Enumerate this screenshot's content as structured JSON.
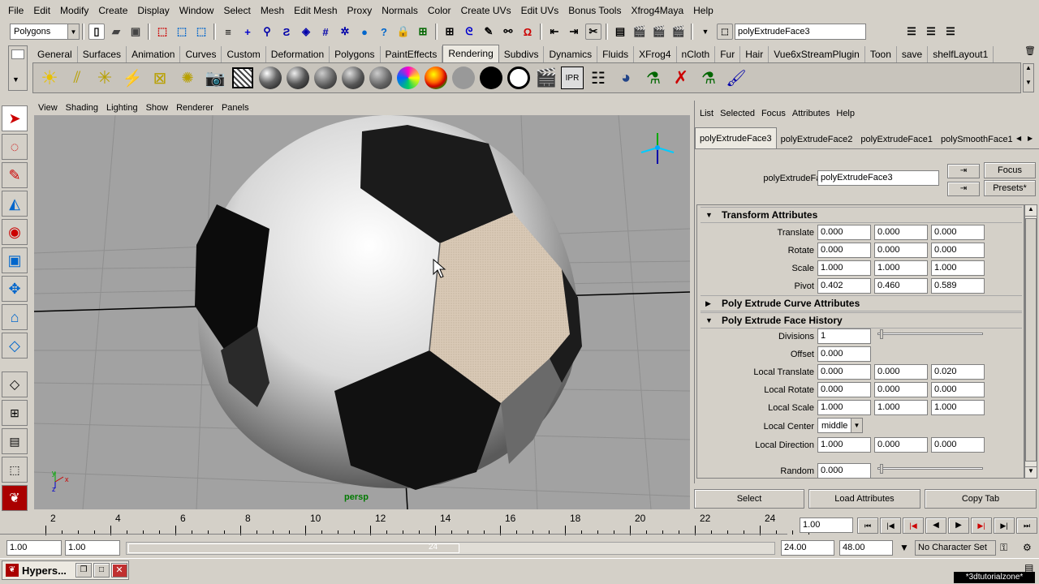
{
  "menubar": [
    "File",
    "Edit",
    "Modify",
    "Create",
    "Display",
    "Window",
    "Select",
    "Mesh",
    "Edit Mesh",
    "Proxy",
    "Normals",
    "Color",
    "Create UVs",
    "Edit UVs",
    "Bonus Tools",
    "Xfrog4Maya",
    "Help"
  ],
  "status": {
    "menuset": "Polygons",
    "name_field": "polyExtrudeFace3"
  },
  "shelf_tabs": [
    "General",
    "Surfaces",
    "Animation",
    "Curves",
    "Custom",
    "Deformation",
    "Polygons",
    "PaintEffects",
    "Rendering",
    "Subdivs",
    "Dynamics",
    "Fluids",
    "XFrog4",
    "nCloth",
    "Fur",
    "Hair",
    "Vue6xStreamPlugin",
    "Toon",
    "save",
    "shelfLayout1"
  ],
  "active_shelf_tab": "Rendering",
  "viewport": {
    "menu": [
      "View",
      "Shading",
      "Lighting",
      "Show",
      "Renderer",
      "Panels"
    ],
    "camera_label": "persp",
    "axis": {
      "x": "x",
      "y": "y",
      "z": "z"
    }
  },
  "ae": {
    "menu": [
      "List",
      "Selected",
      "Focus",
      "Attributes",
      "Help"
    ],
    "tabs": [
      "polyExtrudeFace3",
      "polyExtrudeFace2",
      "polyExtrudeFace1",
      "polySmoothFace1"
    ],
    "node_label": "polyExtrudeFace:",
    "node_value": "polyExtrudeFace3",
    "focus_btn": "Focus",
    "presets_btn": "Presets*",
    "sections": {
      "transform": "Transform Attributes",
      "curve": "Poly Extrude Curve Attributes",
      "history": "Poly Extrude Face History"
    },
    "transform_rows": [
      {
        "label": "Translate",
        "v": [
          "0.000",
          "0.000",
          "0.000"
        ]
      },
      {
        "label": "Rotate",
        "v": [
          "0.000",
          "0.000",
          "0.000"
        ]
      },
      {
        "label": "Scale",
        "v": [
          "1.000",
          "1.000",
          "1.000"
        ]
      },
      {
        "label": "Pivot",
        "v": [
          "0.402",
          "0.460",
          "0.589"
        ]
      }
    ],
    "divisions": {
      "label": "Divisions",
      "value": "1"
    },
    "offset": {
      "label": "Offset",
      "value": "0.000"
    },
    "history_rows": [
      {
        "label": "Local Translate",
        "v": [
          "0.000",
          "0.000",
          "0.020"
        ]
      },
      {
        "label": "Local Rotate",
        "v": [
          "0.000",
          "0.000",
          "0.000"
        ]
      },
      {
        "label": "Local Scale",
        "v": [
          "1.000",
          "1.000",
          "1.000"
        ]
      }
    ],
    "local_center": {
      "label": "Local Center",
      "value": "middle"
    },
    "local_direction": {
      "label": "Local Direction",
      "v": [
        "1.000",
        "0.000",
        "0.000"
      ]
    },
    "random": {
      "label": "Random",
      "value": "0.000"
    },
    "buttons": {
      "select": "Select",
      "load": "Load Attributes",
      "copy": "Copy Tab"
    }
  },
  "timeline": {
    "ticks": [
      "2",
      "4",
      "6",
      "8",
      "10",
      "12",
      "14",
      "16",
      "18",
      "20",
      "22",
      "24"
    ],
    "current_frame": "1.00",
    "range_start": "1.00",
    "range_inner_start": "1.00",
    "range_label": "24",
    "range_end_inner": "24.00",
    "range_end": "48.00",
    "character_set": "No Character Set"
  },
  "taskbar": {
    "window_title": "Hypers...",
    "watermark": "*3dtutorialzone*"
  },
  "colors": {
    "panel": "#d4d0c8",
    "viewport": "#a2a2a2",
    "highlight_face": "#d8c8b4"
  }
}
